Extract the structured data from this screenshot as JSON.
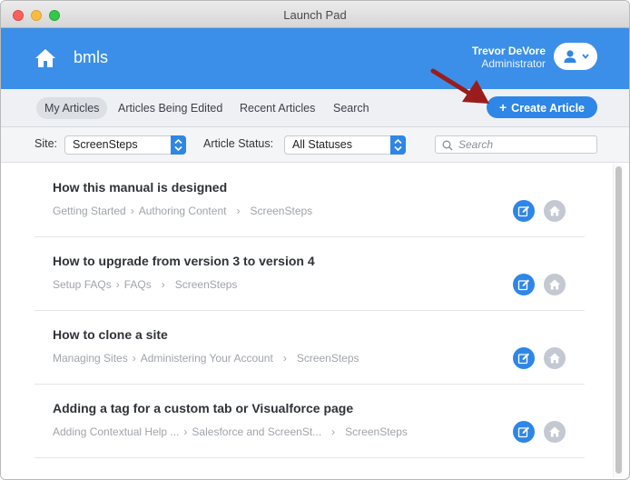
{
  "window": {
    "title": "Launch Pad"
  },
  "header": {
    "site_name": "bmls",
    "user_name": "Trevor DeVore",
    "user_role": "Administrator",
    "home_icon": "home-icon",
    "user_icon": "user-icon"
  },
  "tabs": [
    {
      "label": "My Articles",
      "active": true
    },
    {
      "label": "Articles Being Edited",
      "active": false
    },
    {
      "label": "Recent Articles",
      "active": false
    },
    {
      "label": "Search",
      "active": false
    }
  ],
  "create_button": {
    "label": "Create Article",
    "icon": "plus-icon"
  },
  "filters": {
    "site_label": "Site:",
    "site_value": "ScreenSteps",
    "status_label": "Article Status:",
    "status_value": "All Statuses",
    "search_placeholder": "Search"
  },
  "articles": [
    {
      "title": "How this manual is designed",
      "crumb_1": "Getting Started",
      "crumb_2": "Authoring Content",
      "crumb_3": "ScreenSteps"
    },
    {
      "title": "How to upgrade from version 3 to version 4",
      "crumb_1": "Setup FAQs",
      "crumb_2": "FAQs",
      "crumb_3": "ScreenSteps"
    },
    {
      "title": "How to clone a site",
      "crumb_1": "Managing Sites",
      "crumb_2": "Administering Your Account",
      "crumb_3": "ScreenSteps"
    },
    {
      "title": "Adding a tag for a custom tab or Visualforce page",
      "crumb_1": "Adding Contextual Help ...",
      "crumb_2": "Salesforce and ScreenSt...",
      "crumb_3": "ScreenSteps"
    }
  ],
  "colors": {
    "header_blue": "#3b8fe8",
    "button_blue": "#2e86e6",
    "annotation_arrow": "#9b1c1c"
  }
}
